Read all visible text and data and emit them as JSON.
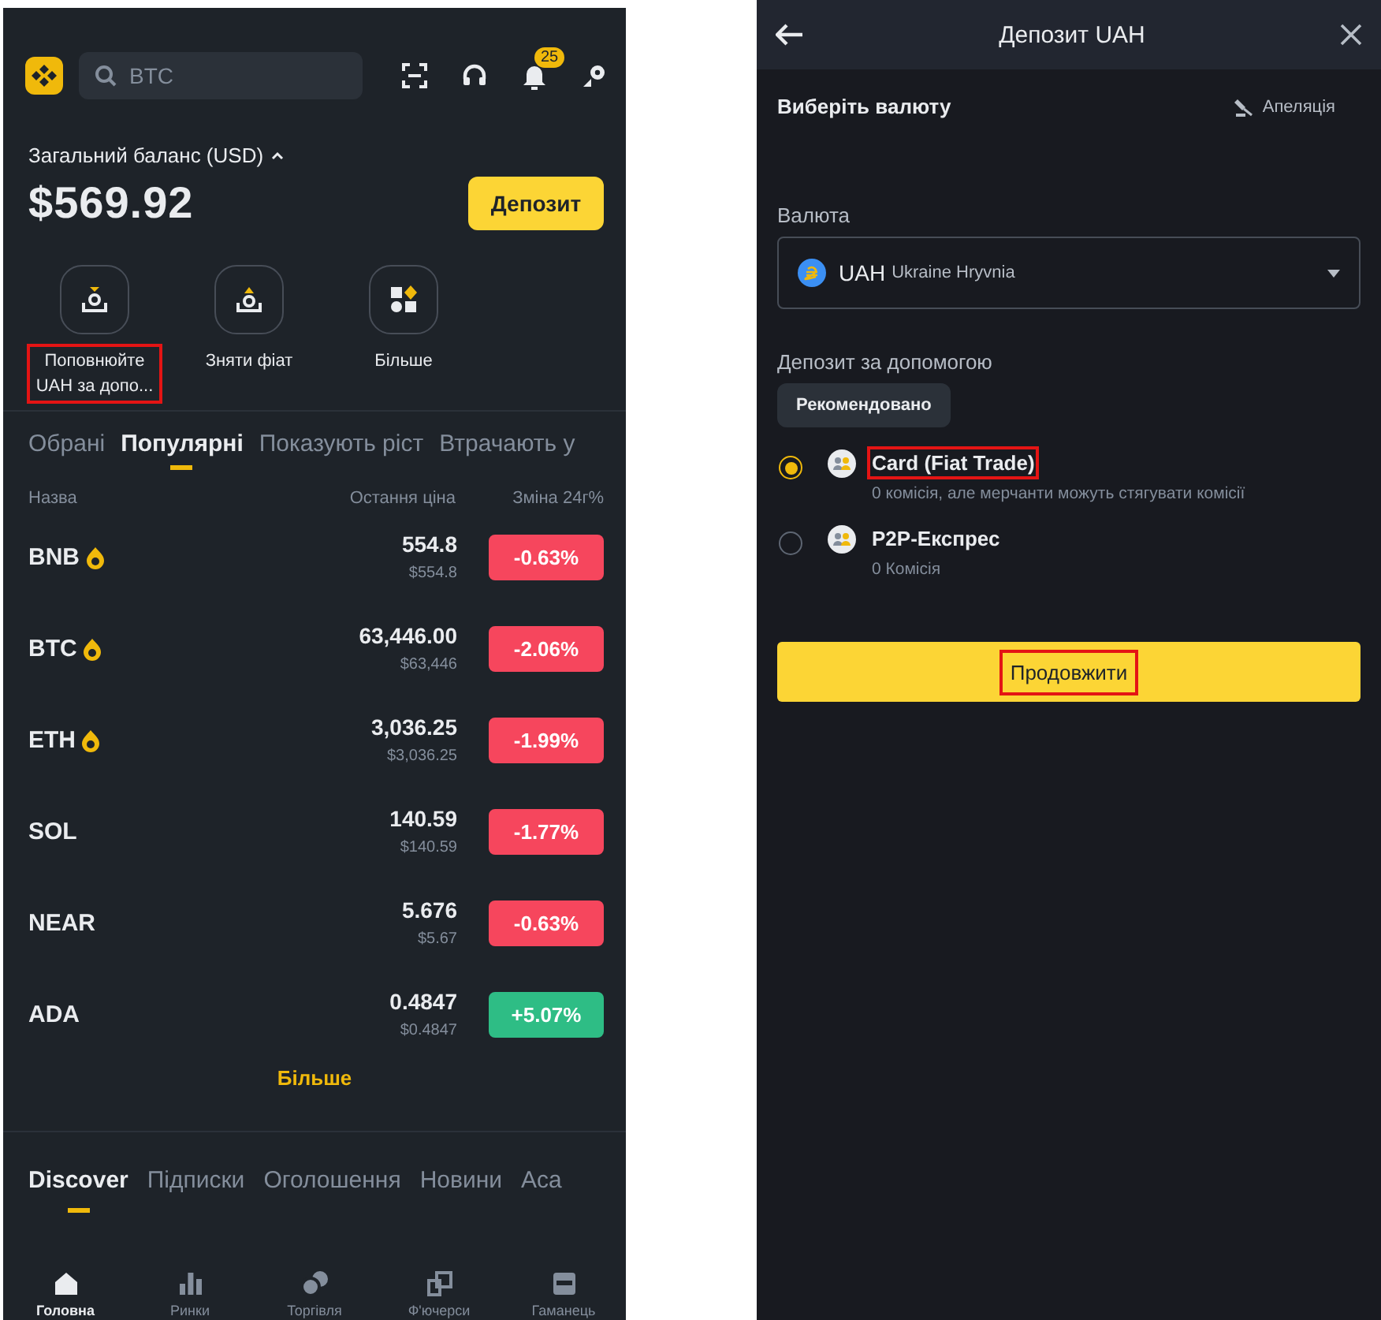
{
  "home": {
    "search": {
      "placeholder": "BTC"
    },
    "notification_badge": "25",
    "balance_label": "Загальний баланс (USD)",
    "balance": "$569.92",
    "deposit_button": "Депозит",
    "quick_actions": [
      {
        "label": "Поповнюйте UAH за допо...",
        "kind": "deposit",
        "highlighted": true
      },
      {
        "label": "Зняти фіат",
        "kind": "withdraw",
        "highlighted": false
      },
      {
        "label": "Більше",
        "kind": "grid",
        "highlighted": false
      }
    ],
    "market_tabs": [
      {
        "label": "Обрані",
        "selected": false
      },
      {
        "label": "Популярні",
        "selected": true
      },
      {
        "label": "Показують ріст",
        "selected": false
      },
      {
        "label": "Втрачають у",
        "selected": false
      }
    ],
    "columns": [
      "Назва",
      "Остання ціна",
      "Зміна 24г%"
    ],
    "rows": [
      {
        "symbol": "BNB",
        "hot": true,
        "price": "554.8",
        "price_usd": "$554.8",
        "change": "-0.63%",
        "color": "#f6465d"
      },
      {
        "symbol": "BTC",
        "hot": true,
        "price": "63,446.00",
        "price_usd": "$63,446",
        "change": "-2.06%",
        "color": "#f6465d"
      },
      {
        "symbol": "ETH",
        "hot": true,
        "price": "3,036.25",
        "price_usd": "$3,036.25",
        "change": "-1.99%",
        "color": "#f6465d"
      },
      {
        "symbol": "SOL",
        "hot": false,
        "price": "140.59",
        "price_usd": "$140.59",
        "change": "-1.77%",
        "color": "#f6465d"
      },
      {
        "symbol": "NEAR",
        "hot": false,
        "price": "5.676",
        "price_usd": "$5.67",
        "change": "-0.63%",
        "color": "#f6465d"
      },
      {
        "symbol": "ADA",
        "hot": false,
        "price": "0.4847",
        "price_usd": "$0.4847",
        "change": "+5.07%",
        "color": "#2ebd85"
      }
    ],
    "more_link": "Більше",
    "discover_tabs": [
      {
        "label": "Discover",
        "selected": true
      },
      {
        "label": "Підписки",
        "selected": false
      },
      {
        "label": "Оголошення",
        "selected": false
      },
      {
        "label": "Новини",
        "selected": false
      },
      {
        "label": "Аса",
        "selected": false
      }
    ],
    "nav": [
      {
        "label": "Головна",
        "kind": "home",
        "selected": true
      },
      {
        "label": "Ринки",
        "kind": "bars",
        "selected": false
      },
      {
        "label": "Торгівля",
        "kind": "trade",
        "selected": false
      },
      {
        "label": "Ф'ючерси",
        "kind": "futures",
        "selected": false
      },
      {
        "label": "Гаманець",
        "kind": "wallet",
        "selected": false
      }
    ]
  },
  "deposit": {
    "title": "Депозит UAH",
    "section_title": "Виберіть валюту",
    "appeal": "Апеляція",
    "currency_label": "Валюта",
    "currency": {
      "code": "UAH",
      "name": "Ukraine Hryvnia"
    },
    "method_label": "Депозит за допомогою",
    "filter_chip": "Рекомендовано",
    "methods": [
      {
        "name": "Card (Fiat Trade)",
        "note": "0 комісія, але мерчанти можуть стягувати комісії",
        "selected": true,
        "highlighted": true
      },
      {
        "name": "P2P-Експрес",
        "note": "0 Комісія",
        "selected": false,
        "highlighted": false
      }
    ],
    "continue_button": {
      "label": "Продовжити",
      "highlighted": true
    }
  }
}
